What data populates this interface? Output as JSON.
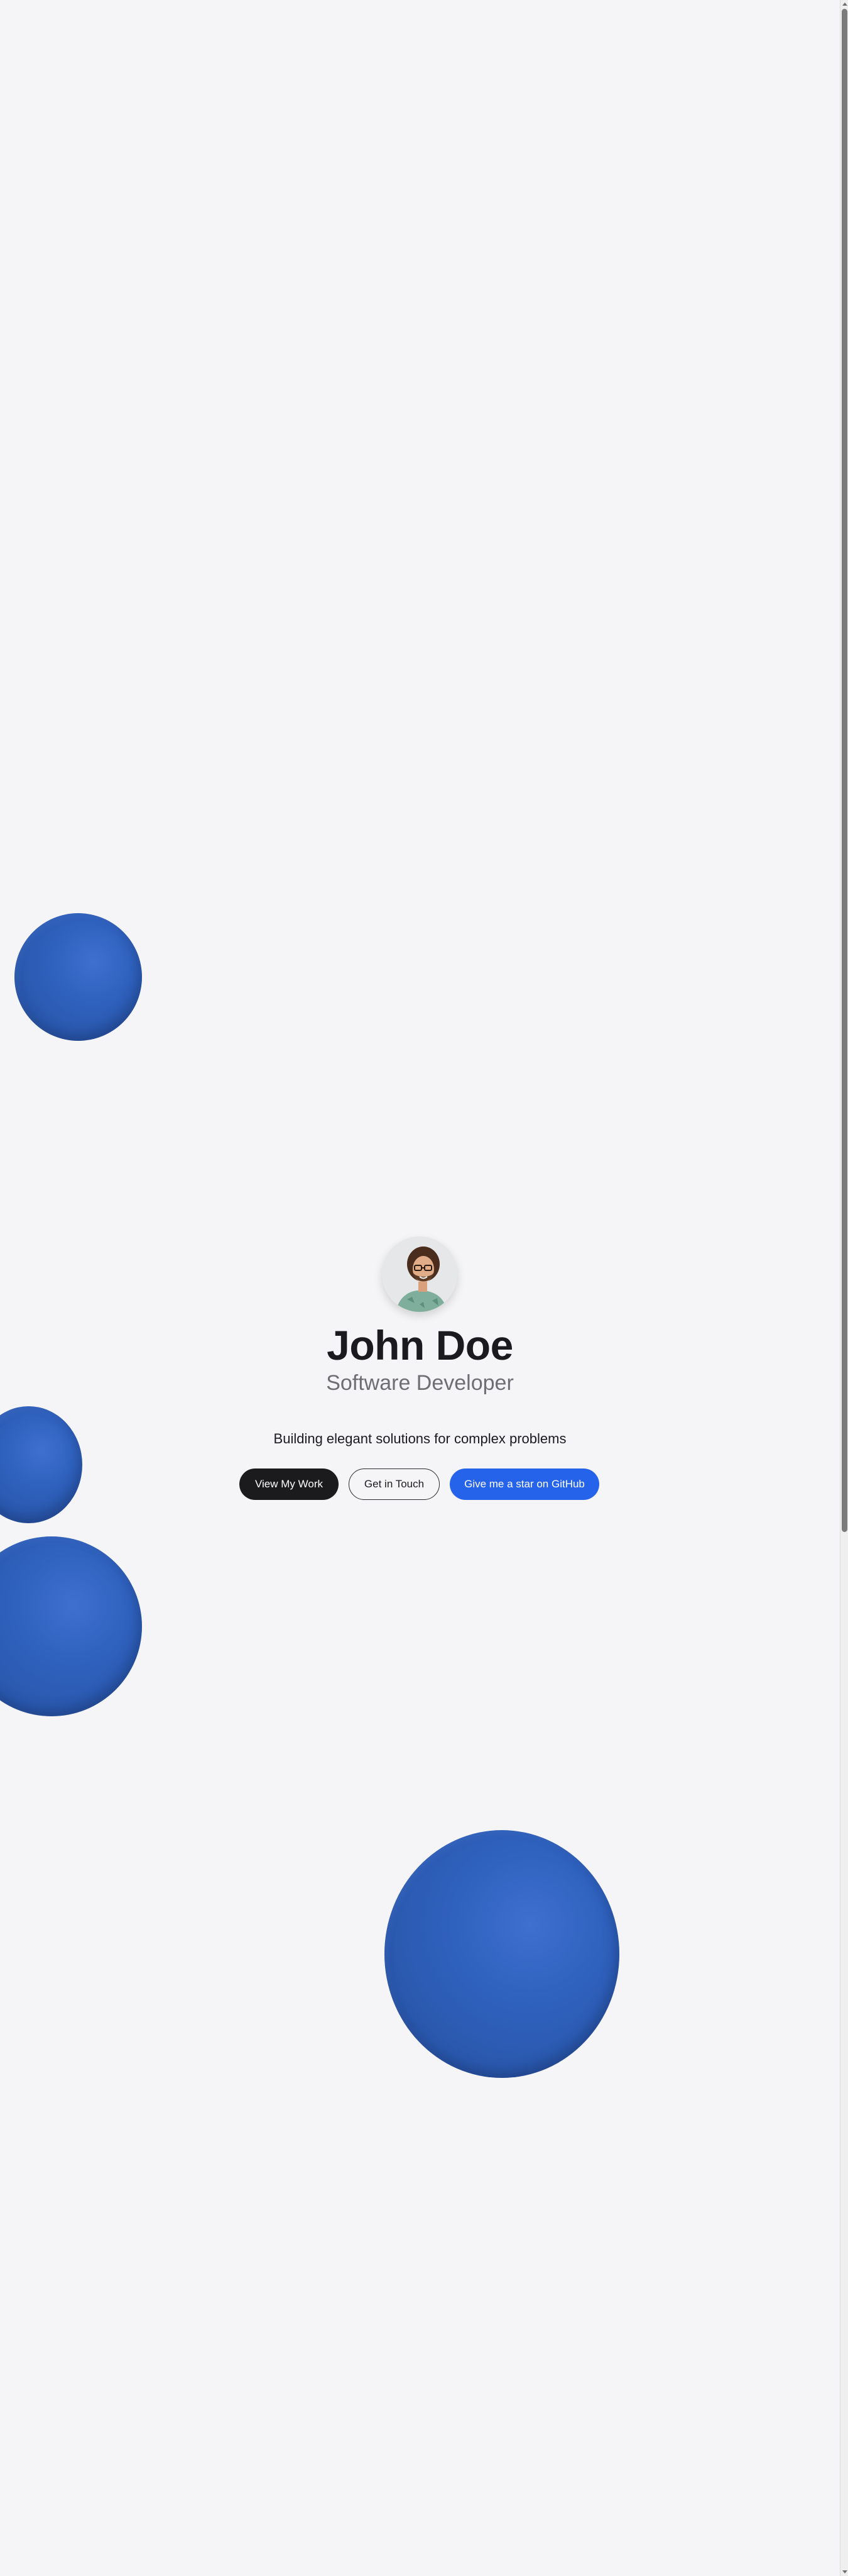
{
  "profile": {
    "name": "John Doe",
    "role": "Software Developer",
    "tagline": "Building elegant solutions for complex problems",
    "avatar_icon": "profile-photo"
  },
  "actions": {
    "view_work": "View My Work",
    "get_in_touch": "Get in Touch",
    "github_star": "Give me a star on GitHub"
  },
  "colors": {
    "background": "#f5f5f7",
    "primary_button": "#1b1b1d",
    "accent": "#2563eb",
    "sphere": "#2f62bf"
  }
}
